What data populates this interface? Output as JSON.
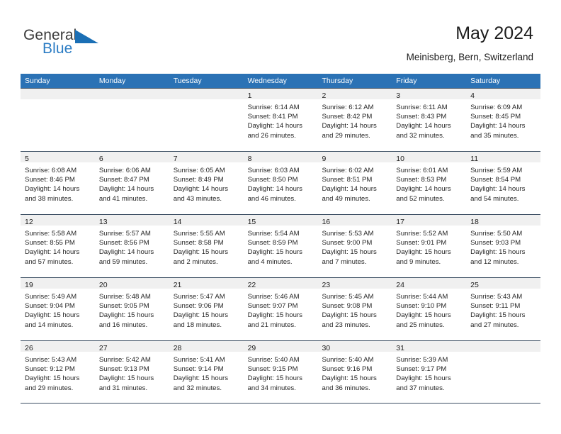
{
  "brand": {
    "name_part1": "General",
    "name_part2": "Blue",
    "accent_color": "#2b7cc4",
    "triangle_color": "#1b6fb5"
  },
  "header": {
    "title": "May 2024",
    "location": "Meinisberg, Bern, Switzerland"
  },
  "calendar": {
    "header_color": "#2b72b5",
    "daynum_band_color": "#f0f0f0",
    "weekday_headers": [
      "Sunday",
      "Monday",
      "Tuesday",
      "Wednesday",
      "Thursday",
      "Friday",
      "Saturday"
    ],
    "weeks": [
      [
        {
          "day": "",
          "lines": []
        },
        {
          "day": "",
          "lines": []
        },
        {
          "day": "",
          "lines": []
        },
        {
          "day": "1",
          "lines": [
            "Sunrise: 6:14 AM",
            "Sunset: 8:41 PM",
            "Daylight: 14 hours",
            "and 26 minutes."
          ]
        },
        {
          "day": "2",
          "lines": [
            "Sunrise: 6:12 AM",
            "Sunset: 8:42 PM",
            "Daylight: 14 hours",
            "and 29 minutes."
          ]
        },
        {
          "day": "3",
          "lines": [
            "Sunrise: 6:11 AM",
            "Sunset: 8:43 PM",
            "Daylight: 14 hours",
            "and 32 minutes."
          ]
        },
        {
          "day": "4",
          "lines": [
            "Sunrise: 6:09 AM",
            "Sunset: 8:45 PM",
            "Daylight: 14 hours",
            "and 35 minutes."
          ]
        }
      ],
      [
        {
          "day": "5",
          "lines": [
            "Sunrise: 6:08 AM",
            "Sunset: 8:46 PM",
            "Daylight: 14 hours",
            "and 38 minutes."
          ]
        },
        {
          "day": "6",
          "lines": [
            "Sunrise: 6:06 AM",
            "Sunset: 8:47 PM",
            "Daylight: 14 hours",
            "and 41 minutes."
          ]
        },
        {
          "day": "7",
          "lines": [
            "Sunrise: 6:05 AM",
            "Sunset: 8:49 PM",
            "Daylight: 14 hours",
            "and 43 minutes."
          ]
        },
        {
          "day": "8",
          "lines": [
            "Sunrise: 6:03 AM",
            "Sunset: 8:50 PM",
            "Daylight: 14 hours",
            "and 46 minutes."
          ]
        },
        {
          "day": "9",
          "lines": [
            "Sunrise: 6:02 AM",
            "Sunset: 8:51 PM",
            "Daylight: 14 hours",
            "and 49 minutes."
          ]
        },
        {
          "day": "10",
          "lines": [
            "Sunrise: 6:01 AM",
            "Sunset: 8:53 PM",
            "Daylight: 14 hours",
            "and 52 minutes."
          ]
        },
        {
          "day": "11",
          "lines": [
            "Sunrise: 5:59 AM",
            "Sunset: 8:54 PM",
            "Daylight: 14 hours",
            "and 54 minutes."
          ]
        }
      ],
      [
        {
          "day": "12",
          "lines": [
            "Sunrise: 5:58 AM",
            "Sunset: 8:55 PM",
            "Daylight: 14 hours",
            "and 57 minutes."
          ]
        },
        {
          "day": "13",
          "lines": [
            "Sunrise: 5:57 AM",
            "Sunset: 8:56 PM",
            "Daylight: 14 hours",
            "and 59 minutes."
          ]
        },
        {
          "day": "14",
          "lines": [
            "Sunrise: 5:55 AM",
            "Sunset: 8:58 PM",
            "Daylight: 15 hours",
            "and 2 minutes."
          ]
        },
        {
          "day": "15",
          "lines": [
            "Sunrise: 5:54 AM",
            "Sunset: 8:59 PM",
            "Daylight: 15 hours",
            "and 4 minutes."
          ]
        },
        {
          "day": "16",
          "lines": [
            "Sunrise: 5:53 AM",
            "Sunset: 9:00 PM",
            "Daylight: 15 hours",
            "and 7 minutes."
          ]
        },
        {
          "day": "17",
          "lines": [
            "Sunrise: 5:52 AM",
            "Sunset: 9:01 PM",
            "Daylight: 15 hours",
            "and 9 minutes."
          ]
        },
        {
          "day": "18",
          "lines": [
            "Sunrise: 5:50 AM",
            "Sunset: 9:03 PM",
            "Daylight: 15 hours",
            "and 12 minutes."
          ]
        }
      ],
      [
        {
          "day": "19",
          "lines": [
            "Sunrise: 5:49 AM",
            "Sunset: 9:04 PM",
            "Daylight: 15 hours",
            "and 14 minutes."
          ]
        },
        {
          "day": "20",
          "lines": [
            "Sunrise: 5:48 AM",
            "Sunset: 9:05 PM",
            "Daylight: 15 hours",
            "and 16 minutes."
          ]
        },
        {
          "day": "21",
          "lines": [
            "Sunrise: 5:47 AM",
            "Sunset: 9:06 PM",
            "Daylight: 15 hours",
            "and 18 minutes."
          ]
        },
        {
          "day": "22",
          "lines": [
            "Sunrise: 5:46 AM",
            "Sunset: 9:07 PM",
            "Daylight: 15 hours",
            "and 21 minutes."
          ]
        },
        {
          "day": "23",
          "lines": [
            "Sunrise: 5:45 AM",
            "Sunset: 9:08 PM",
            "Daylight: 15 hours",
            "and 23 minutes."
          ]
        },
        {
          "day": "24",
          "lines": [
            "Sunrise: 5:44 AM",
            "Sunset: 9:10 PM",
            "Daylight: 15 hours",
            "and 25 minutes."
          ]
        },
        {
          "day": "25",
          "lines": [
            "Sunrise: 5:43 AM",
            "Sunset: 9:11 PM",
            "Daylight: 15 hours",
            "and 27 minutes."
          ]
        }
      ],
      [
        {
          "day": "26",
          "lines": [
            "Sunrise: 5:43 AM",
            "Sunset: 9:12 PM",
            "Daylight: 15 hours",
            "and 29 minutes."
          ]
        },
        {
          "day": "27",
          "lines": [
            "Sunrise: 5:42 AM",
            "Sunset: 9:13 PM",
            "Daylight: 15 hours",
            "and 31 minutes."
          ]
        },
        {
          "day": "28",
          "lines": [
            "Sunrise: 5:41 AM",
            "Sunset: 9:14 PM",
            "Daylight: 15 hours",
            "and 32 minutes."
          ]
        },
        {
          "day": "29",
          "lines": [
            "Sunrise: 5:40 AM",
            "Sunset: 9:15 PM",
            "Daylight: 15 hours",
            "and 34 minutes."
          ]
        },
        {
          "day": "30",
          "lines": [
            "Sunrise: 5:40 AM",
            "Sunset: 9:16 PM",
            "Daylight: 15 hours",
            "and 36 minutes."
          ]
        },
        {
          "day": "31",
          "lines": [
            "Sunrise: 5:39 AM",
            "Sunset: 9:17 PM",
            "Daylight: 15 hours",
            "and 37 minutes."
          ]
        },
        {
          "day": "",
          "lines": []
        }
      ]
    ]
  }
}
